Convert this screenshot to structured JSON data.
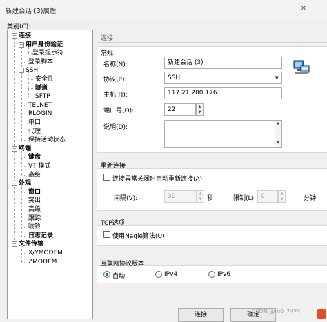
{
  "window": {
    "title": "新建会话 (3)属性",
    "close": "✕"
  },
  "category_label": "类别(C):",
  "tree": [
    {
      "label": "连接",
      "bold": true
    },
    {
      "label": "用户身份验证",
      "bold": true
    },
    {
      "label": "登录提示符",
      "bold": false
    },
    {
      "label": "登录脚本",
      "bold": false
    },
    {
      "label": "SSH",
      "bold": false
    },
    {
      "label": "安全性",
      "bold": false
    },
    {
      "label": "隧道",
      "bold": true
    },
    {
      "label": "SFTP",
      "bold": false
    },
    {
      "label": "TELNET",
      "bold": false
    },
    {
      "label": "RLOGIN",
      "bold": false
    },
    {
      "label": "串口",
      "bold": false
    },
    {
      "label": "代理",
      "bold": false
    },
    {
      "label": "保持活动状态",
      "bold": false
    },
    {
      "label": "终端",
      "bold": true
    },
    {
      "label": "键盘",
      "bold": true
    },
    {
      "label": "VT 模式",
      "bold": false
    },
    {
      "label": "高级",
      "bold": false
    },
    {
      "label": "外观",
      "bold": true
    },
    {
      "label": "窗口",
      "bold": true
    },
    {
      "label": "突出",
      "bold": false
    },
    {
      "label": "高级",
      "bold": false
    },
    {
      "label": "跟踪",
      "bold": false
    },
    {
      "label": "响铃",
      "bold": false
    },
    {
      "label": "日志记录",
      "bold": true
    },
    {
      "label": "文件传输",
      "bold": true
    },
    {
      "label": "X/YMODEM",
      "bold": false
    },
    {
      "label": "ZMODEM",
      "bold": false
    }
  ],
  "breadcrumb": "连接",
  "general": {
    "heading": "常规",
    "name_label": "名称(N):",
    "name_value": "新建会话 (3)",
    "protocol_label": "协议(P):",
    "protocol_value": "SSH",
    "host_label": "主机(H):",
    "host_value": "117.21.200.176",
    "port_label": "端口号(O):",
    "port_value": "22",
    "desc_label": "说明(D):",
    "desc_value": ""
  },
  "reconnect": {
    "heading": "重新连接",
    "checkbox_label": "连接异常关闭时自动重新连接(A)",
    "interval_label": "间隔(V):",
    "interval_value": "30",
    "interval_unit": "秒",
    "limit_label": "限制(L):",
    "limit_value": "0",
    "limit_unit": "分钟"
  },
  "tcp": {
    "heading": "TCP选项",
    "nagle_label": "使用Nagle算法(U)"
  },
  "ip": {
    "heading": "互联网协议版本",
    "options": [
      "自动",
      "IPv4",
      "IPv6"
    ],
    "selected": "自动"
  },
  "buttons": {
    "connect": "连接",
    "confirm": "确定"
  },
  "watermark": "CSDN @m0_7474"
}
